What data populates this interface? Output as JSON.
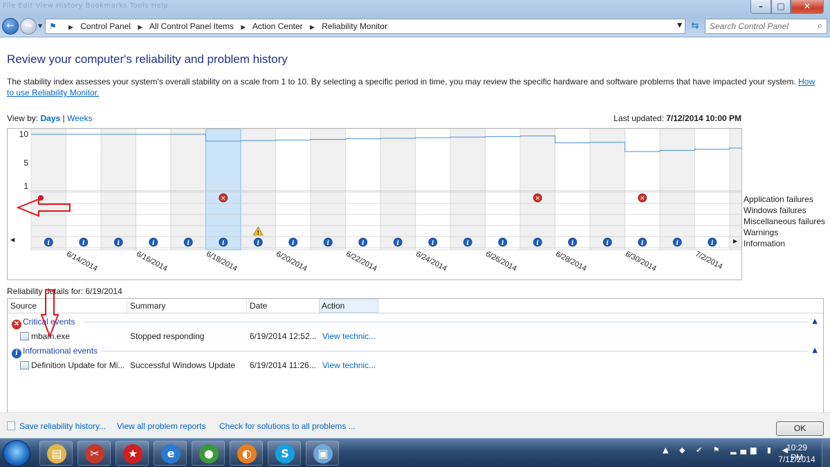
{
  "window": {
    "menu_ghost": "File  Edit  View  History  Bookmarks  Tools  Help",
    "min_glyph": "–",
    "max_glyph": "□",
    "close_glyph": "✕"
  },
  "address_bar": {
    "breadcrumbs": [
      "Control Panel",
      "All Control Panel Items",
      "Action Center",
      "Reliability Monitor"
    ]
  },
  "search": {
    "placeholder": "Search Control Panel"
  },
  "page": {
    "title": "Review your computer's reliability and problem history",
    "description": "The stability index assesses your system's overall stability on a scale from 1 to 10. By selecting a specific period in time, you may review the specific hardware and software problems that have impacted your system.",
    "description_link": "How to use Reliability Monitor.",
    "view_by_label": "View by:",
    "view_by_days": "Days",
    "view_by_sep": "|",
    "view_by_weeks": "Weeks",
    "last_updated_label": "Last updated:",
    "last_updated_value": "7/12/2014 10:00 PM"
  },
  "chart_data": {
    "type": "line",
    "y_ticks": [
      "10",
      "5",
      "1"
    ],
    "ylim": [
      1,
      10
    ],
    "selected_column": 5,
    "columns": [
      "6/13/2014",
      "6/14/2014",
      "6/15/2014",
      "6/16/2014",
      "6/17/2014",
      "6/18/2014",
      "6/19/2014",
      "6/20/2014",
      "6/21/2014",
      "6/22/2014",
      "6/23/2014",
      "6/24/2014",
      "6/25/2014",
      "6/26/2014",
      "6/27/2014",
      "6/28/2014",
      "6/29/2014",
      "6/30/2014",
      "7/1/2014",
      "7/2/2014",
      "7/3/2014"
    ],
    "x_tick_labels": [
      "6/14/2014",
      "6/16/2014",
      "6/18/2014",
      "6/20/2014",
      "6/22/2014",
      "6/24/2014",
      "6/26/2014",
      "6/28/2014",
      "6/30/2014",
      "7/2/2014"
    ],
    "stability_index": [
      10,
      10,
      10,
      10,
      10,
      8.8,
      8.9,
      9.0,
      9.1,
      9.2,
      9.3,
      9.4,
      9.5,
      9.6,
      9.7,
      8.5,
      8.6,
      7.0,
      7.2,
      7.4,
      7.6
    ],
    "rows": [
      "Application failures",
      "Windows failures",
      "Miscellaneous failures",
      "Warnings",
      "Information"
    ],
    "application_failures": [
      5,
      14,
      17
    ],
    "warnings": [
      6
    ],
    "information": [
      0,
      1,
      2,
      3,
      4,
      5,
      6,
      7,
      8,
      9,
      10,
      11,
      12,
      13,
      14,
      15,
      16,
      17,
      18,
      19
    ]
  },
  "details": {
    "label": "Reliability details for: 6/19/2014",
    "columns": {
      "source": "Source",
      "summary": "Summary",
      "date": "Date",
      "action": "Action"
    },
    "groups": {
      "critical": {
        "label": "Critical events",
        "rows": [
          {
            "source": "mbam.exe",
            "summary": "Stopped responding",
            "date": "6/19/2014 12:52...",
            "action": "View  technic..."
          }
        ]
      },
      "informational": {
        "label": "Informational events",
        "rows": [
          {
            "source": "Definition Update for Mi...",
            "summary": "Successful Windows Update",
            "date": "6/19/2014 11:26...",
            "action": "View  technic..."
          }
        ]
      }
    }
  },
  "footer": {
    "save": "Save reliability history...",
    "view_all": "View all problem reports",
    "check": "Check for solutions to all problems ...",
    "ok": "OK"
  },
  "taskbar": {
    "time": "10:29 PM",
    "date": "7/12/2014",
    "apps": [
      {
        "name": "explorer",
        "glyph": "▤",
        "color": "#e2b64a"
      },
      {
        "name": "snipping-tool",
        "glyph": "✂",
        "color": "#c0392b"
      },
      {
        "name": "pokerstars",
        "glyph": "★",
        "color": "#cf1f1f"
      },
      {
        "name": "internet-explorer",
        "glyph": "e",
        "color": "#2a7bd0"
      },
      {
        "name": "chrome",
        "glyph": "●",
        "color": "#3c9a3c"
      },
      {
        "name": "firefox",
        "glyph": "◐",
        "color": "#e67e22"
      },
      {
        "name": "skype",
        "glyph": "S",
        "color": "#14a0e0"
      },
      {
        "name": "control-panel",
        "glyph": "▣",
        "color": "#6fa8d6"
      }
    ]
  },
  "colors": {
    "accent_link": "#0066cc",
    "title": "#1e3287",
    "line": "#4a90d9",
    "selected_column": "#cce4f7",
    "annotation_red": "#e0141e"
  }
}
